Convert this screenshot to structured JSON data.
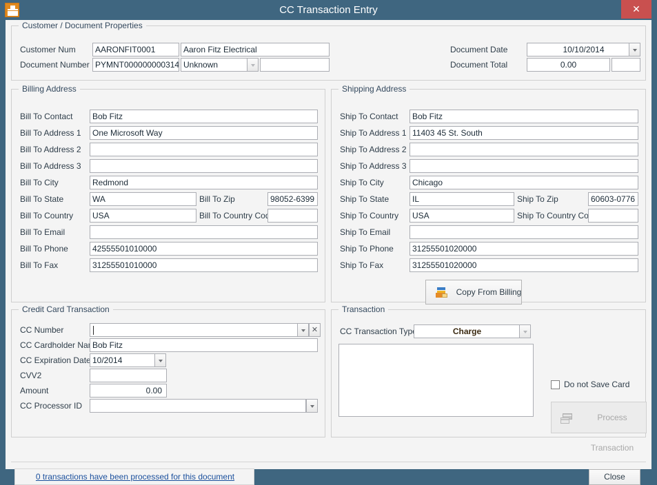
{
  "window": {
    "title": "CC Transaction Entry",
    "app_icon": "register-icon",
    "close_label": "✕",
    "accent_color": "#3f6680",
    "close_button_color": "#c9504f"
  },
  "customer_section": {
    "legend": "Customer / Document Properties",
    "fields": [
      {
        "label": "Customer Num",
        "value": "AARONFIT0001"
      },
      {
        "label": "",
        "value": "Aaron Fitz Electrical"
      },
      {
        "label": "Document Number",
        "value": "PYMNT000000000314"
      },
      {
        "label": "",
        "value": "Unknown"
      },
      {
        "label": "",
        "value": ""
      }
    ],
    "customer_num_label": "Customer Num",
    "customer_num_value": "AARONFIT0001",
    "customer_name_value": "Aaron Fitz Electrical",
    "document_number_label": "Document Number",
    "document_number_value": "PYMNT000000000314",
    "document_type_value": "Unknown",
    "document_extra_value": "",
    "document_date_label": "Document Date",
    "document_date_value": "10/10/2014",
    "document_total_label": "Document Total",
    "document_total_value": "0.00",
    "document_total_extra": ""
  },
  "billing_section": {
    "legend": "Billing Address",
    "rows": [
      {
        "label": "Bill To Contact",
        "value": "Bob Fitz"
      },
      {
        "label": "Bill To Address 1",
        "value": "One Microsoft Way"
      },
      {
        "label": "Bill To Address 2",
        "value": ""
      },
      {
        "label": "Bill To Address 3",
        "value": ""
      },
      {
        "label": "Bill To City",
        "value": "Redmond"
      }
    ],
    "state_label": "Bill To State",
    "state_value": "WA",
    "zip_label": "Bill To Zip",
    "zip_value": "98052-6399",
    "country_label": "Bill To Country",
    "country_value": "USA",
    "country_code_label": "Bill To Country Code",
    "country_code_value": "",
    "email_label": "Bill To Email",
    "email_value": "",
    "phone_label": "Bill To Phone",
    "phone_value": "42555501010000",
    "fax_label": "Bill To Fax",
    "fax_value": "31255501010000"
  },
  "shipping_section": {
    "legend": "Shipping Address",
    "rows": [
      {
        "label": "Ship To Contact",
        "value": "Bob Fitz"
      },
      {
        "label": "Ship To Address 1",
        "value": "11403 45 St. South"
      },
      {
        "label": "Ship To Address 2",
        "value": ""
      },
      {
        "label": "Ship To Address 3",
        "value": ""
      },
      {
        "label": "Ship To City",
        "value": "Chicago"
      }
    ],
    "state_label": "Ship To State",
    "state_value": "IL",
    "zip_label": "Ship To Zip",
    "zip_value": "60603-0776",
    "country_label": "Ship To Country",
    "country_value": "USA",
    "country_code_label": "Ship To Country Code",
    "country_code_value": "",
    "email_label": "Ship To Email",
    "email_value": "",
    "phone_label": "Ship To Phone",
    "phone_value": "31255501020000",
    "fax_label": "Ship To Fax",
    "fax_value": "31255501020000",
    "copy_button_label": "Copy From Billing",
    "copy_button_icon": "copy-from-billing-icon"
  },
  "credit_card_section": {
    "legend": "Credit Card Transaction",
    "cc_number_label": "CC Number",
    "cc_number_value": "",
    "cc_cardholder_label": "CC Cardholder Name",
    "cc_cardholder_value": "Bob Fitz",
    "cc_expiration_label": "CC Expiration Date",
    "cc_expiration_value": "10/2014",
    "cvv2_label": "CVV2",
    "cvv2_value": "",
    "amount_label": "Amount",
    "amount_value": "0.00",
    "cc_processor_label": "CC Processor ID",
    "cc_processor_value": ""
  },
  "transaction_section": {
    "legend": "Transaction",
    "type_label": "CC Transaction Type",
    "type_value": "Charge",
    "response_value": "",
    "do_not_save_label": "Do not Save Card",
    "do_not_save_checked": false,
    "process_button_label": "Process Transaction",
    "process_button_icon": "process-transaction-icon",
    "process_button_disabled": true
  },
  "footer": {
    "transactions_link": "0 transactions have been processed for this document",
    "close_label": "Close"
  }
}
